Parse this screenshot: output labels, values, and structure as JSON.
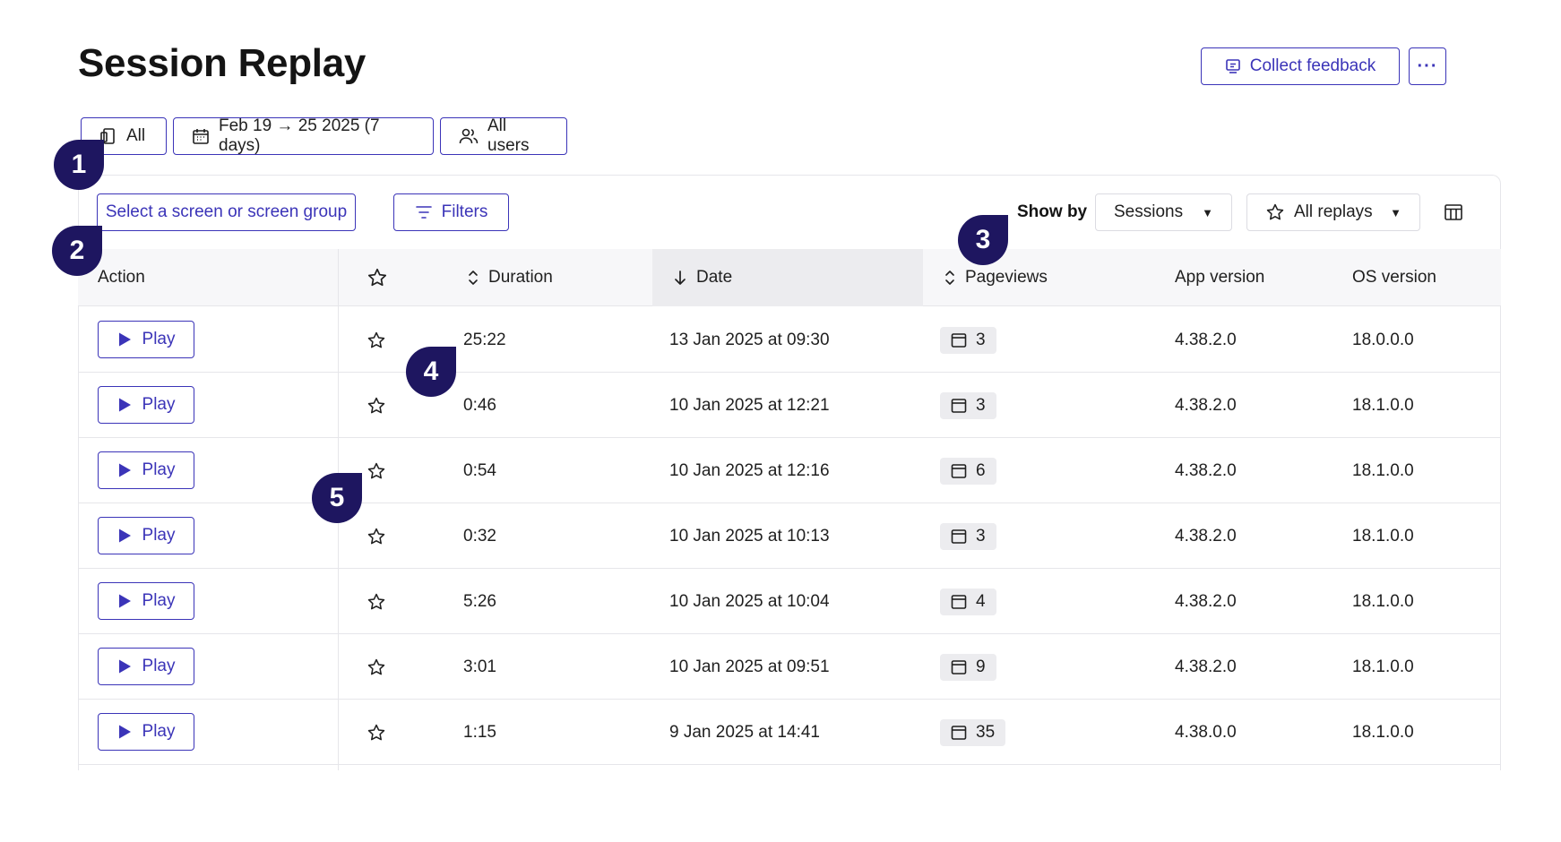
{
  "page": {
    "title": "Session Replay"
  },
  "header": {
    "collect_feedback_label": "Collect feedback",
    "more_label": "···"
  },
  "filters_bar": {
    "platform_label": "All",
    "date_range_label": "Feb 19 → 25 2025 (7 days)",
    "users_label": "All users"
  },
  "toolbar": {
    "screen_select_placeholder": "Select a screen or screen group",
    "filters_label": "Filters",
    "show_by_label": "Show by",
    "show_by_value": "Sessions",
    "replays_value": "All replays"
  },
  "table": {
    "columns": {
      "action": "Action",
      "duration": "Duration",
      "date": "Date",
      "pageviews": "Pageviews",
      "app_version": "App version",
      "os_version": "OS version"
    },
    "play_label": "Play",
    "rows": [
      {
        "duration": "25:22",
        "date": "13 Jan 2025 at 09:30",
        "pageviews": "3",
        "app_version": "4.38.2.0",
        "os_version": "18.0.0.0"
      },
      {
        "duration": "0:46",
        "date": "10 Jan 2025 at 12:21",
        "pageviews": "3",
        "app_version": "4.38.2.0",
        "os_version": "18.1.0.0"
      },
      {
        "duration": "0:54",
        "date": "10 Jan 2025 at 12:16",
        "pageviews": "6",
        "app_version": "4.38.2.0",
        "os_version": "18.1.0.0"
      },
      {
        "duration": "0:32",
        "date": "10 Jan 2025 at 10:13",
        "pageviews": "3",
        "app_version": "4.38.2.0",
        "os_version": "18.1.0.0"
      },
      {
        "duration": "5:26",
        "date": "10 Jan 2025 at 10:04",
        "pageviews": "4",
        "app_version": "4.38.2.0",
        "os_version": "18.1.0.0"
      },
      {
        "duration": "3:01",
        "date": "10 Jan 2025 at 09:51",
        "pageviews": "9",
        "app_version": "4.38.2.0",
        "os_version": "18.1.0.0"
      },
      {
        "duration": "1:15",
        "date": "9 Jan 2025 at 14:41",
        "pageviews": "35",
        "app_version": "4.38.0.0",
        "os_version": "18.1.0.0"
      }
    ]
  },
  "callouts": [
    "1",
    "2",
    "3",
    "4",
    "5"
  ],
  "icons": {
    "platform": "device-icon",
    "calendar": "calendar-icon",
    "users": "users-icon",
    "filters": "filter-icon",
    "star": "star-icon",
    "columns": "columns-icon",
    "play": "play-icon",
    "pageview": "pageview-icon",
    "feedback": "feedback-icon"
  },
  "colors": {
    "accent": "#3b34b8",
    "callout": "#1e1660",
    "header_bg": "#f7f7f9",
    "badge_bg": "#ececef"
  }
}
